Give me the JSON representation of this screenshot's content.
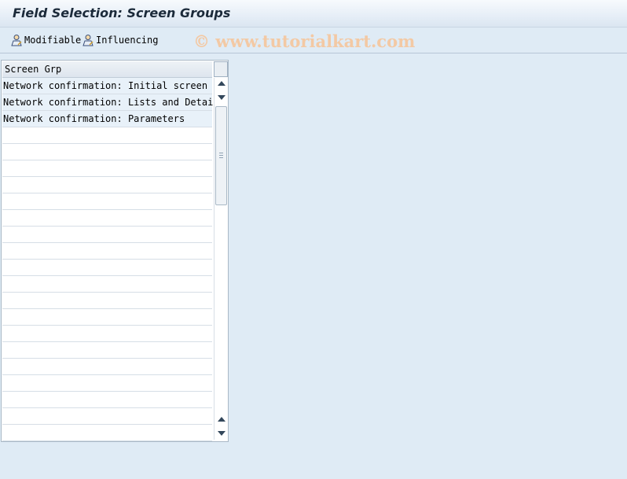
{
  "window": {
    "title": "Field Selection: Screen Groups"
  },
  "toolbar": {
    "modifiable_label": "Modifiable",
    "influencing_label": "Influencing"
  },
  "watermark": "© www.tutorialkart.com",
  "grid": {
    "column_header": "Screen Grp",
    "rows": [
      "Network confirmation: Initial screen",
      "Network confirmation: Lists and Details",
      "Network confirmation: Parameters"
    ]
  },
  "colors": {
    "background": "#dfebf5",
    "title_text": "#1b2a3a",
    "filled_row": "#e8f1f9",
    "watermark": "#f3c9a4"
  },
  "icons": [
    "person-pen-icon",
    "person-pen-icon"
  ]
}
